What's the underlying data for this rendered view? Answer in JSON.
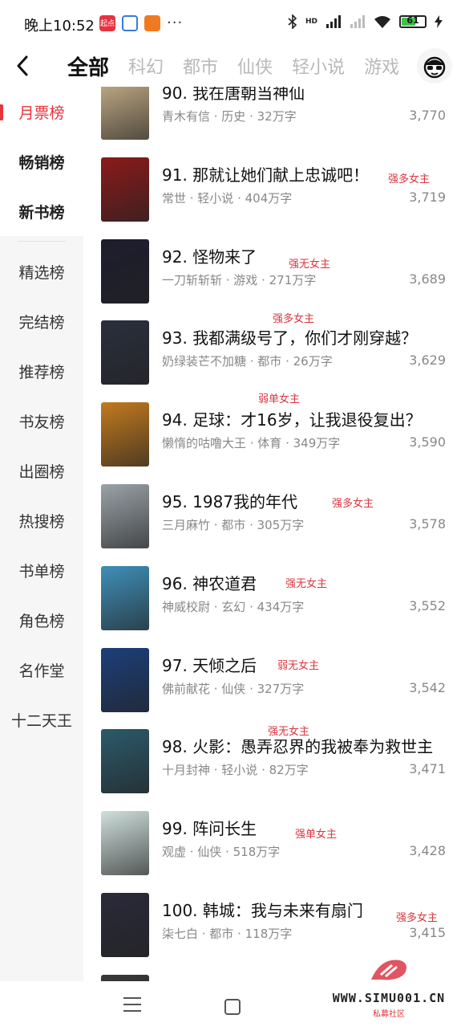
{
  "status_bar": {
    "time": "晚上10:52",
    "app_badge_1": "起点",
    "more": "···",
    "network": "HD",
    "battery": "61",
    "battery_level": 0.61,
    "battery_color": "#3cc24a"
  },
  "nav": {
    "tabs": [
      "全部",
      "科幻",
      "都市",
      "仙侠",
      "轻小说",
      "游戏"
    ],
    "active_tab": 0
  },
  "sidebar": {
    "items": [
      "月票榜",
      "畅销榜",
      "新书榜",
      "精选榜",
      "完结榜",
      "推荐榜",
      "书友榜",
      "出圈榜",
      "热搜榜",
      "书单榜",
      "角色榜",
      "名作堂",
      "十二天王"
    ],
    "active": 0
  },
  "books": [
    {
      "title": "90. 我在唐朝当神仙",
      "meta": "青木有信 · 历史 · 32万字",
      "count": "3,770",
      "tag": "",
      "cover": "#c9b28a"
    },
    {
      "title": "91. 那就让她们献上忠诚吧！",
      "meta": "常世 · 轻小说 · 404万字",
      "count": "3,719",
      "tag": "强多女主",
      "cover": "#8b1a1a"
    },
    {
      "title": "92. 怪物来了",
      "meta": "一刀斩斩斩 · 游戏 · 271万字",
      "count": "3,689",
      "tag": "强无女主",
      "cover": "#1d1d2e"
    },
    {
      "title": "93. 我都满级号了，你们才刚穿越？",
      "meta": "奶绿装芒不加糖 · 都市 · 26万字",
      "count": "3,629",
      "tag": "强多女主",
      "cover": "#2a2f3d"
    },
    {
      "title": "94. 足球：才16岁，让我退役复出？",
      "meta": "懒惰的咕噜大王 · 体育 · 349万字",
      "count": "3,590",
      "tag": "弱单女主",
      "cover": "#c27a1f"
    },
    {
      "title": "95. 1987我的年代",
      "meta": "三月麻竹 · 都市 · 305万字",
      "count": "3,578",
      "tag": "强多女主",
      "cover": "#9aa3a8"
    },
    {
      "title": "96. 神农道君",
      "meta": "神威校尉 · 玄幻 · 434万字",
      "count": "3,552",
      "tag": "强无女主",
      "cover": "#3f8fb8"
    },
    {
      "title": "97. 天倾之后",
      "meta": "佛前献花 · 仙侠 · 327万字",
      "count": "3,542",
      "tag": "弱无女主",
      "cover": "#1c3f7a"
    },
    {
      "title": "98. 火影：愚弄忍界的我被奉为救世主",
      "meta": "十月封神 · 轻小说 · 82万字",
      "count": "3,471",
      "tag": "强无女主",
      "cover": "#2c5a6a"
    },
    {
      "title": "99. 阵问长生",
      "meta": "观虚 · 仙侠 · 518万字",
      "count": "3,428",
      "tag": "强单女主",
      "cover": "#cfe0dc"
    },
    {
      "title": "100. 韩城：我与未来有扇门",
      "meta": "柒七白 · 都市 · 118万字",
      "count": "3,415",
      "tag": "强多女主",
      "cover": "#2a2a3a"
    }
  ],
  "watermark": {
    "text": "WWW.SIMU001.CN",
    "sub": "私募社区"
  },
  "colors": {
    "accent": "#e8333c",
    "tag": "#d9363e"
  }
}
